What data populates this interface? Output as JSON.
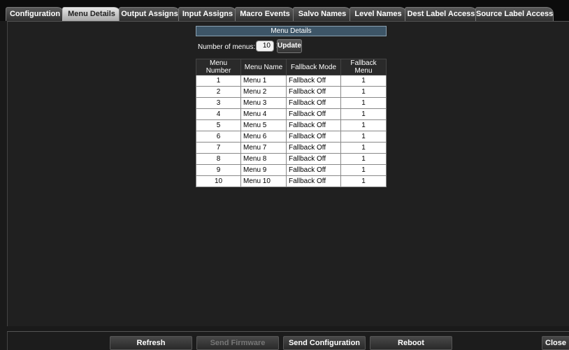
{
  "tabs": [
    {
      "label": "Configuration",
      "active": false
    },
    {
      "label": "Menu Details",
      "active": true
    },
    {
      "label": "Output Assigns",
      "active": false
    },
    {
      "label": "Input Assigns",
      "active": false
    },
    {
      "label": "Macro Events",
      "active": false
    },
    {
      "label": "Salvo Names",
      "active": false
    },
    {
      "label": "Level Names",
      "active": false
    },
    {
      "label": "Dest Label Access",
      "active": false
    },
    {
      "label": "Source Label Access",
      "active": false
    }
  ],
  "panel": {
    "title": "Menu Details",
    "number_label": "Number of menus:",
    "number_value": "10",
    "update_label": "Update"
  },
  "table": {
    "headers": [
      "Menu Number",
      "Menu Name",
      "Fallback Mode",
      "Fallback Menu"
    ],
    "rows": [
      [
        "1",
        "Menu 1",
        "Fallback Off",
        "1"
      ],
      [
        "2",
        "Menu 2",
        "Fallback Off",
        "1"
      ],
      [
        "3",
        "Menu 3",
        "Fallback Off",
        "1"
      ],
      [
        "4",
        "Menu 4",
        "Fallback Off",
        "1"
      ],
      [
        "5",
        "Menu 5",
        "Fallback Off",
        "1"
      ],
      [
        "6",
        "Menu 6",
        "Fallback Off",
        "1"
      ],
      [
        "7",
        "Menu 7",
        "Fallback Off",
        "1"
      ],
      [
        "8",
        "Menu 8",
        "Fallback Off",
        "1"
      ],
      [
        "9",
        "Menu 9",
        "Fallback Off",
        "1"
      ],
      [
        "10",
        "Menu 10",
        "Fallback Off",
        "1"
      ]
    ]
  },
  "bottom": {
    "refresh": "Refresh",
    "send_firmware": "Send Firmware",
    "send_configuration": "Send Configuration",
    "reboot": "Reboot",
    "close": "Close"
  },
  "colors": {
    "title_bar": "#3d5567",
    "active_tab": "#d0d0d0",
    "background": "#202020"
  }
}
